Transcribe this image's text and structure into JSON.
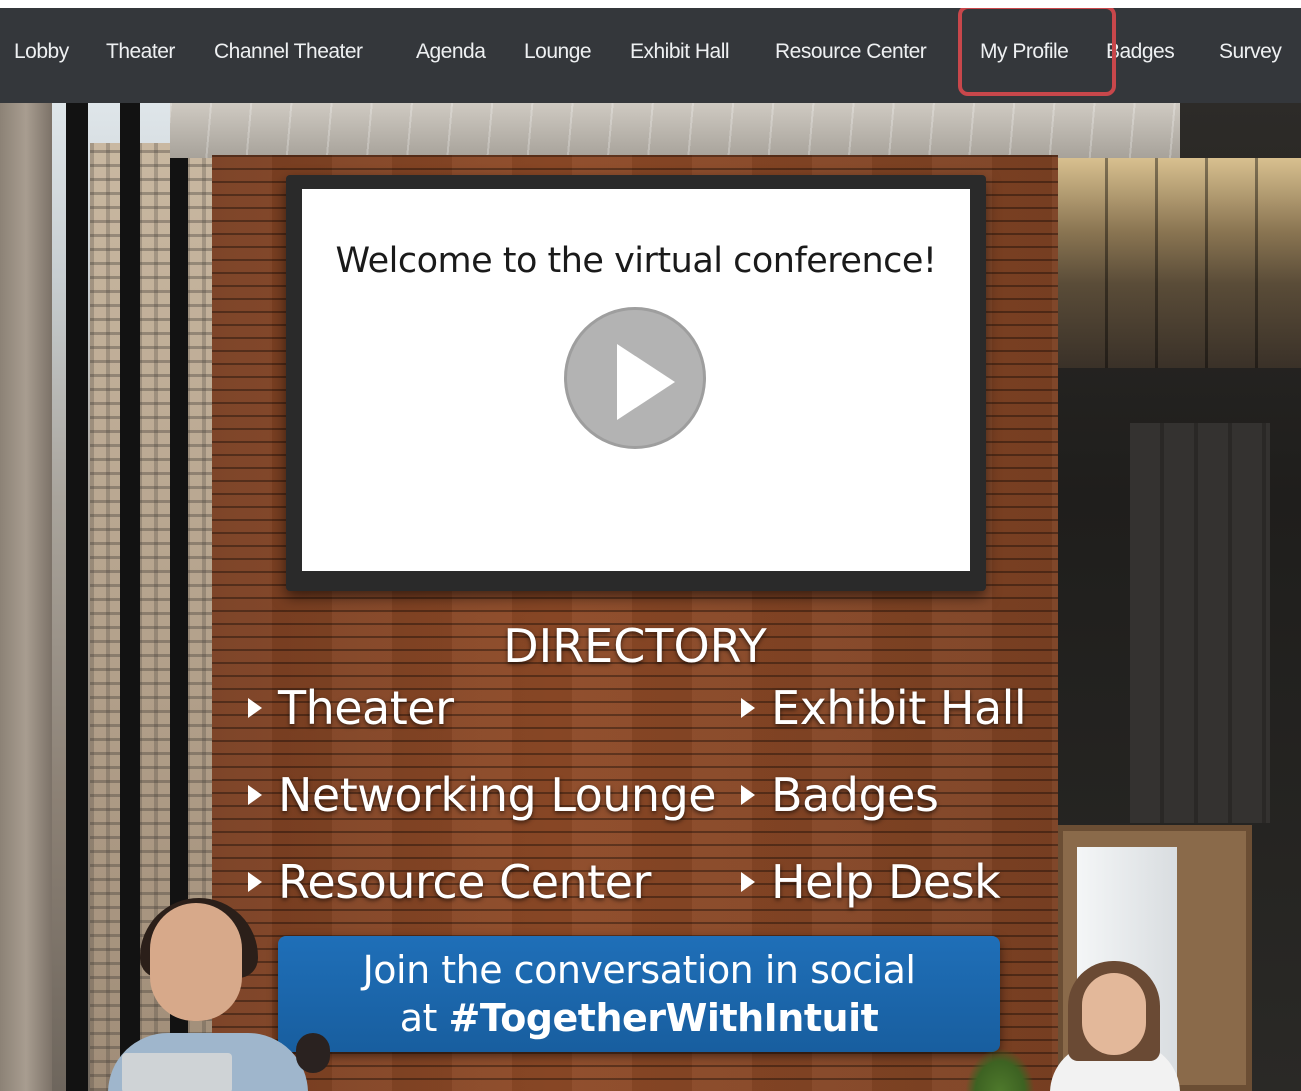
{
  "nav": {
    "items": [
      {
        "label": "Lobby"
      },
      {
        "label": "Theater"
      },
      {
        "label": "Channel Theater"
      },
      {
        "label": "Agenda"
      },
      {
        "label": "Lounge"
      },
      {
        "label": "Exhibit Hall"
      },
      {
        "label": "Resource Center"
      },
      {
        "label": "My Profile",
        "highlighted": true
      },
      {
        "label": "Badges"
      },
      {
        "label": "Survey"
      }
    ],
    "highlight_color": "#c8474b",
    "background_color": "#34373b"
  },
  "video": {
    "title": "Welcome to the virtual conference!",
    "play_icon": "play-icon"
  },
  "directory": {
    "title": "DIRECTORY",
    "items": [
      {
        "label": "Theater"
      },
      {
        "label": "Exhibit Hall"
      },
      {
        "label": "Networking Lounge"
      },
      {
        "label": "Badges"
      },
      {
        "label": "Resource Center"
      },
      {
        "label": "Help Desk"
      }
    ]
  },
  "social_banner": {
    "line1": "Join the conversation in social",
    "line2_prefix": "at ",
    "hashtag": "#TogetherWithIntuit",
    "color": "#1f6fb8"
  }
}
